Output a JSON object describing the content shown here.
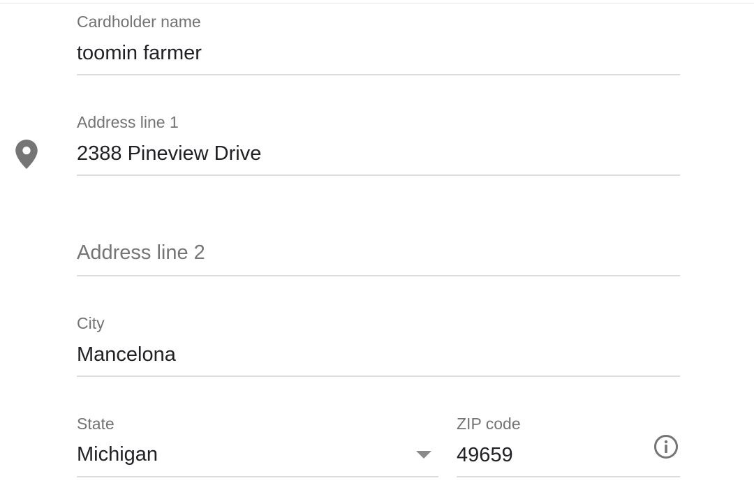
{
  "form": {
    "cardholder_name": {
      "label": "Cardholder name",
      "value": "toomin farmer"
    },
    "address_line_1": {
      "label": "Address line 1",
      "value": "2388 Pineview Drive",
      "icon": "location-pin-icon"
    },
    "address_line_2": {
      "placeholder": "Address line 2",
      "value": ""
    },
    "city": {
      "label": "City",
      "value": "Mancelona"
    },
    "state": {
      "label": "State",
      "value": "Michigan",
      "icon": "dropdown-arrow-icon"
    },
    "zip": {
      "label": "ZIP code",
      "value": "49659",
      "icon": "info-icon"
    }
  },
  "colors": {
    "label": "#737373",
    "value": "#202124",
    "underline": "#dcdcdc",
    "icon": "#757575"
  }
}
